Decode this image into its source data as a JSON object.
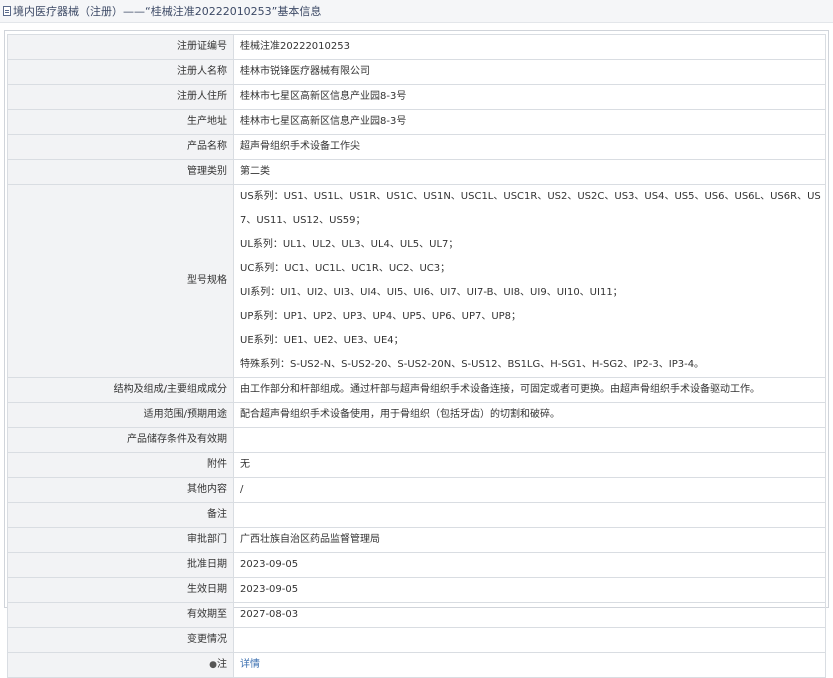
{
  "header": {
    "title": "境内医疗器械（注册）——“桂械注准20222010253”基本信息"
  },
  "rows": [
    {
      "label": "注册证编号",
      "value": "桂械注准20222010253"
    },
    {
      "label": "注册人名称",
      "value": "桂林市锐锋医疗器械有限公司"
    },
    {
      "label": "注册人住所",
      "value": "桂林市七星区高新区信息产业园8-3号"
    },
    {
      "label": "生产地址",
      "value": "桂林市七星区高新区信息产业园8-3号"
    },
    {
      "label": "产品名称",
      "value": "超声骨组织手术设备工作尖"
    },
    {
      "label": "管理类别",
      "value": "第二类"
    },
    {
      "label": "型号规格",
      "lines": [
        "US系列：US1、US1L、US1R、US1C、US1N、USC1L、USC1R、US2、US2C、US3、US4、US5、US6、US6L、US6R、US7、US11、US12、US59；",
        "UL系列：UL1、UL2、UL3、UL4、UL5、UL7；",
        "UC系列：UC1、UC1L、UC1R、UC2、UC3；",
        "UI系列：UI1、UI2、UI3、UI4、UI5、UI6、UI7、UI7-B、UI8、UI9、UI10、UI11；",
        "UP系列：UP1、UP2、UP3、UP4、UP5、UP6、UP7、UP8；",
        "UE系列：UE1、UE2、UE3、UE4；",
        "特殊系列：S-US2-N、S-US2-20、S-US2-20N、S-US12、BS1LG、H-SG1、H-SG2、IP2-3、IP3-4。"
      ]
    },
    {
      "label": "结构及组成/主要组成成分",
      "value": "由工作部分和杆部组成。通过杆部与超声骨组织手术设备连接，可固定或者可更换。由超声骨组织手术设备驱动工作。"
    },
    {
      "label": "适用范围/预期用途",
      "value": "配合超声骨组织手术设备使用，用于骨组织（包括牙齿）的切割和破碎。"
    },
    {
      "label": "产品储存条件及有效期",
      "value": ""
    },
    {
      "label": "附件",
      "value": "无"
    },
    {
      "label": "其他内容",
      "value": "/"
    },
    {
      "label": "备注",
      "value": ""
    },
    {
      "label": "审批部门",
      "value": "广西壮族自治区药品监督管理局"
    },
    {
      "label": "批准日期",
      "value": "2023-09-05"
    },
    {
      "label": "生效日期",
      "value": "2023-09-05"
    },
    {
      "label": "有效期至",
      "value": "2027-08-03"
    },
    {
      "label": "变更情况",
      "value": ""
    },
    {
      "label": "注",
      "value": "详情"
    }
  ]
}
